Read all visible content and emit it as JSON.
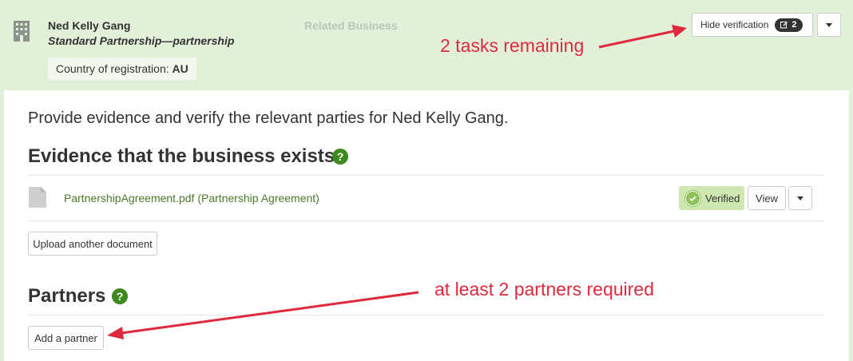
{
  "header": {
    "business_name": "Ned Kelly Gang",
    "business_type": "Standard Partnership—partnership",
    "country_label": "Country of registration:",
    "country_value": "AU",
    "related_label": "Related Business",
    "icon": "building-icon",
    "hide_verification_label": "Hide verification",
    "task_count": "2"
  },
  "annotations": {
    "tasks_remaining": "2 tasks remaining",
    "partners_required": "at least 2 partners required",
    "arrow_color": "#e0293e"
  },
  "main": {
    "intro": "Provide evidence and verify the relevant parties for Ned Kelly Gang.",
    "evidence_heading": "Evidence that the business exists",
    "help_glyph": "?",
    "document": {
      "name": "PartnershipAgreement.pdf (Partnership Agreement)",
      "status": "Verified",
      "view_label": "View"
    },
    "upload_label": "Upload another document",
    "partners_heading": "Partners",
    "add_partner_label": "Add a partner"
  },
  "colors": {
    "header_bg": "#e2f0d9",
    "accent_green": "#3f8a1f",
    "verified_bg": "#cfe8b2",
    "link_green": "#4a7a2a"
  }
}
